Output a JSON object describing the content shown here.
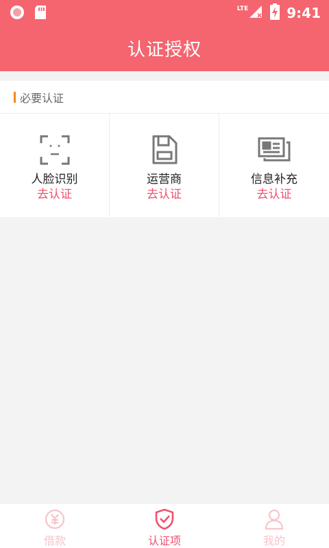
{
  "status_bar": {
    "network": "LTE",
    "time": "9:41"
  },
  "app_bar": {
    "title": "认证授权"
  },
  "section": {
    "title": "必要认证"
  },
  "auth_items": [
    {
      "name": "人脸识别",
      "action": "去认证",
      "icon": "face-scan-icon"
    },
    {
      "name": "运营商",
      "action": "去认证",
      "icon": "sim-card-icon"
    },
    {
      "name": "信息补充",
      "action": "去认证",
      "icon": "id-card-icon"
    }
  ],
  "tabs": [
    {
      "label": "借款",
      "icon": "yuan-coin-icon",
      "active": false
    },
    {
      "label": "认证项",
      "icon": "shield-check-icon",
      "active": true
    },
    {
      "label": "我的",
      "icon": "user-icon",
      "active": false
    }
  ],
  "colors": {
    "brand": "#f4656f",
    "accent_text": "#f0506e",
    "section_marker": "#f08a1c",
    "inactive_tab": "#f7c4c9"
  }
}
